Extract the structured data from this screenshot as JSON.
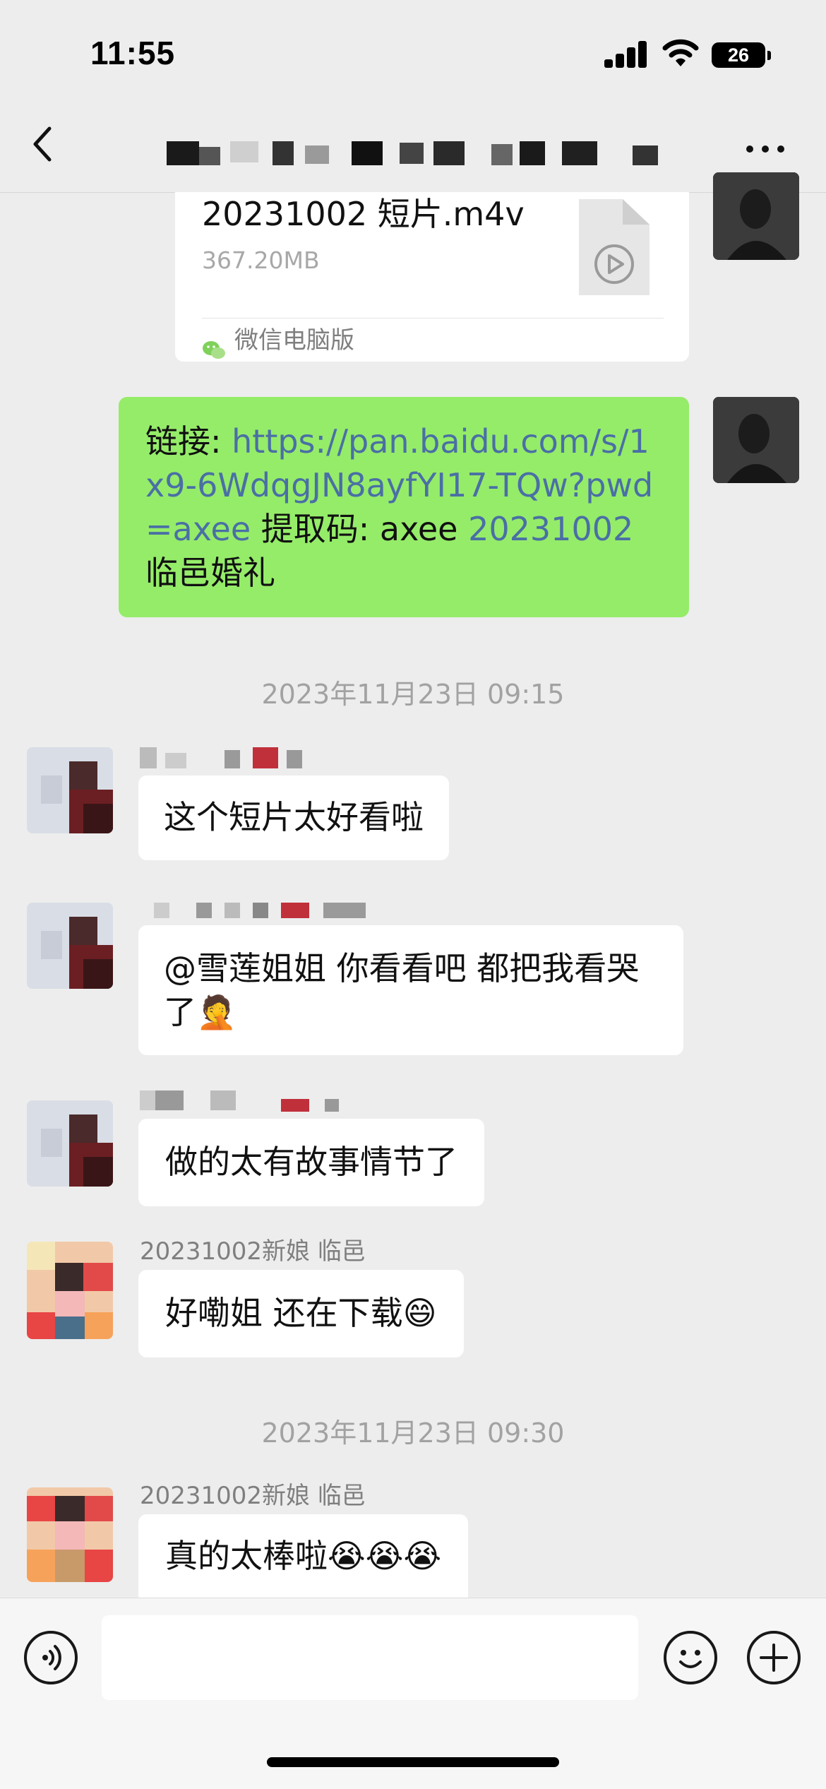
{
  "status_bar": {
    "time": "11:55",
    "battery": "26"
  },
  "header": {
    "back_icon": "chevron-left-icon",
    "more_icon": "ellipsis-icon"
  },
  "messages": {
    "file_card": {
      "name": "20231002 短片.m4v",
      "size": "367.20MB",
      "source": "微信电脑版"
    },
    "link_message": {
      "prefix": "链接: ",
      "url": "https://pan.baidu.com/s/1x9-6WdqgJN8ayfYI17-TQw?pwd=axee",
      "code_label": " 提取码: axee  ",
      "tag": "20231002",
      "suffix": "临邑婚礼"
    },
    "timestamp_1": "2023年11月23日 09:15",
    "msg1": "这个短片太好看啦",
    "msg2_text": "@雪莲姐姐 你看看吧 都把我看哭了",
    "msg3": "做的太有故事情节了",
    "msg4_sender": "20231002新娘 临邑",
    "msg4_text": "好嘞姐 还在下载",
    "timestamp_2": "2023年11月23日 09:30",
    "msg5_sender": "20231002新娘 临邑",
    "msg5_text": "真的太棒啦"
  },
  "emoji": {
    "facepalm": "🤦",
    "grin": "😄",
    "cry": "😭"
  },
  "colors": {
    "background": "#ededed",
    "sent_bubble": "#95ec69",
    "link": "#4a6fa5"
  }
}
